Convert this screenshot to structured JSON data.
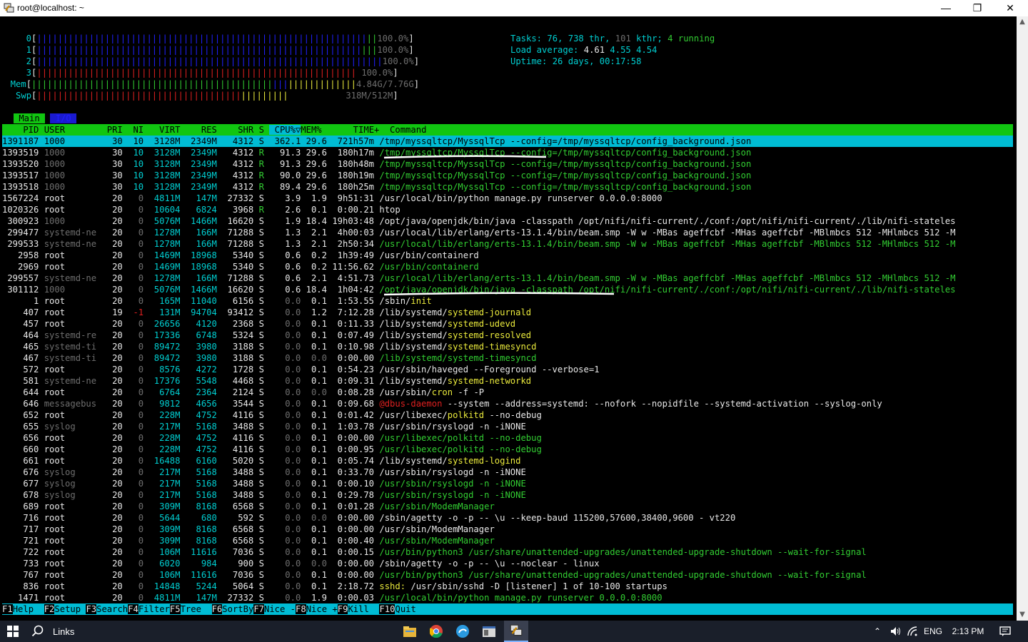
{
  "window": {
    "title": "root@localhost: ~"
  },
  "meters": {
    "cpu": [
      {
        "label": "0",
        "value": "100.0%"
      },
      {
        "label": "1",
        "value": "100.0%"
      },
      {
        "label": "2",
        "value": "100.0%"
      },
      {
        "label": "3",
        "value": "100.0%"
      }
    ],
    "mem": {
      "label": "Mem",
      "value": "4.84G/7.76G"
    },
    "swp": {
      "label": "Swp",
      "value": "318M/512M"
    }
  },
  "stats": {
    "tasks_label": "Tasks:",
    "tasks": "76,",
    "threads": "738",
    "threads_label": "thr,",
    "kthreads": "101",
    "kthreads_label": "kthr;",
    "running": "4",
    "running_label": "running",
    "load_label": "Load average:",
    "load1": "4.61",
    "load5": "4.55",
    "load15": "4.54",
    "uptime_label": "Uptime:",
    "uptime": "26 days, 00:17:58"
  },
  "tabs": [
    "Main",
    "I/O"
  ],
  "columns": [
    "PID",
    "USER",
    "PRI",
    "NI",
    "VIRT",
    "RES",
    "SHR",
    "S",
    "CPU%",
    "MEM%",
    "TIME+",
    "Command"
  ],
  "processes": [
    [
      "1391187",
      "1000",
      "30",
      "10",
      "3128M",
      "2349M",
      "4312",
      "S",
      "362.1",
      "29.6",
      "721h57m",
      "/tmp/myssqltcp/MyssqlTcp --config=/tmp/myssqltcp/config_background.json"
    ],
    [
      "1393519",
      "1000",
      "30",
      "10",
      "3128M",
      "2349M",
      "4312",
      "R",
      "91.3",
      "29.6",
      "180h17m",
      "/tmp/myssqltcp/MyssqlTcp --config=/tmp/myssqltcp/config_background.json"
    ],
    [
      "1393520",
      "1000",
      "30",
      "10",
      "3128M",
      "2349M",
      "4312",
      "R",
      "91.3",
      "29.6",
      "180h48m",
      "/tmp/myssqltcp/MyssqlTcp --config=/tmp/myssqltcp/config_background.json"
    ],
    [
      "1393517",
      "1000",
      "30",
      "10",
      "3128M",
      "2349M",
      "4312",
      "R",
      "90.0",
      "29.6",
      "180h19m",
      "/tmp/myssqltcp/MyssqlTcp --config=/tmp/myssqltcp/config_background.json"
    ],
    [
      "1393518",
      "1000",
      "30",
      "10",
      "3128M",
      "2349M",
      "4312",
      "R",
      "89.4",
      "29.6",
      "180h25m",
      "/tmp/myssqltcp/MyssqlTcp --config=/tmp/myssqltcp/config_background.json"
    ],
    [
      "1567224",
      "root",
      "20",
      "0",
      "4811M",
      "147M",
      "27332",
      "S",
      "3.9",
      "1.9",
      "9h51:31",
      "/usr/local/bin/python manage.py runserver 0.0.0.0:8000"
    ],
    [
      "1020326",
      "root",
      "20",
      "0",
      "10604",
      "6824",
      "3968",
      "R",
      "2.6",
      "0.1",
      "0:00.21",
      "htop"
    ],
    [
      "300923",
      "1000",
      "20",
      "0",
      "5076M",
      "1466M",
      "16620",
      "S",
      "1.9",
      "18.4",
      "19h03:48",
      "/opt/java/openjdk/bin/java -classpath /opt/nifi/nifi-current/./conf:/opt/nifi/nifi-current/./lib/nifi-stateles"
    ],
    [
      "299477",
      "systemd-ne",
      "20",
      "0",
      "1278M",
      "166M",
      "71288",
      "S",
      "1.3",
      "2.1",
      "4h00:03",
      "/usr/local/lib/erlang/erts-13.1.4/bin/beam.smp -W w -MBas ageffcbf -MHas ageffcbf -MBlmbcs 512 -MHlmbcs 512 -M"
    ],
    [
      "299533",
      "systemd-ne",
      "20",
      "0",
      "1278M",
      "166M",
      "71288",
      "S",
      "1.3",
      "2.1",
      "2h50:34",
      "/usr/local/lib/erlang/erts-13.1.4/bin/beam.smp -W w -MBas ageffcbf -MHas ageffcbf -MBlmbcs 512 -MHlmbcs 512 -M"
    ],
    [
      "2958",
      "root",
      "20",
      "0",
      "1469M",
      "18968",
      "5340",
      "S",
      "0.6",
      "0.2",
      "1h39:49",
      "/usr/bin/containerd"
    ],
    [
      "2969",
      "root",
      "20",
      "0",
      "1469M",
      "18968",
      "5340",
      "S",
      "0.6",
      "0.2",
      "11:56.62",
      "/usr/bin/containerd"
    ],
    [
      "299557",
      "systemd-ne",
      "20",
      "0",
      "1278M",
      "166M",
      "71288",
      "S",
      "0.6",
      "2.1",
      "4:51.73",
      "/usr/local/lib/erlang/erts-13.1.4/bin/beam.smp -W w -MBas ageffcbf -MHas ageffcbf -MBlmbcs 512 -MHlmbcs 512 -M"
    ],
    [
      "301112",
      "1000",
      "20",
      "0",
      "5076M",
      "1466M",
      "16620",
      "S",
      "0.6",
      "18.4",
      "1h04:42",
      "/opt/java/openjdk/bin/java -classpath /opt/nifi/nifi-current/./conf:/opt/nifi/nifi-current/./lib/nifi-stateles"
    ],
    [
      "1",
      "root",
      "20",
      "0",
      "165M",
      "11040",
      "6156",
      "S",
      "0.0",
      "0.1",
      "1:53.55",
      "/sbin/init"
    ],
    [
      "407",
      "root",
      "19",
      "-1",
      "131M",
      "94704",
      "93412",
      "S",
      "0.0",
      "1.2",
      "7:12.28",
      "/lib/systemd/systemd-journald"
    ],
    [
      "457",
      "root",
      "20",
      "0",
      "26656",
      "4120",
      "2368",
      "S",
      "0.0",
      "0.1",
      "0:11.33",
      "/lib/systemd/systemd-udevd"
    ],
    [
      "464",
      "systemd-re",
      "20",
      "0",
      "17336",
      "6748",
      "5324",
      "S",
      "0.0",
      "0.1",
      "0:07.49",
      "/lib/systemd/systemd-resolved"
    ],
    [
      "465",
      "systemd-ti",
      "20",
      "0",
      "89472",
      "3980",
      "3188",
      "S",
      "0.0",
      "0.1",
      "0:10.98",
      "/lib/systemd/systemd-timesyncd"
    ],
    [
      "467",
      "systemd-ti",
      "20",
      "0",
      "89472",
      "3980",
      "3188",
      "S",
      "0.0",
      "0.0",
      "0:00.00",
      "/lib/systemd/systemd-timesyncd"
    ],
    [
      "572",
      "root",
      "20",
      "0",
      "8576",
      "4272",
      "1728",
      "S",
      "0.0",
      "0.1",
      "0:54.23",
      "/usr/sbin/haveged --Foreground --verbose=1"
    ],
    [
      "581",
      "systemd-ne",
      "20",
      "0",
      "17376",
      "5548",
      "4468",
      "S",
      "0.0",
      "0.1",
      "0:09.31",
      "/lib/systemd/systemd-networkd"
    ],
    [
      "644",
      "root",
      "20",
      "0",
      "6764",
      "2364",
      "2124",
      "S",
      "0.0",
      "0.0",
      "0:08.28",
      "/usr/sbin/cron -f -P"
    ],
    [
      "646",
      "messagebus",
      "20",
      "0",
      "9812",
      "4656",
      "3544",
      "S",
      "0.0",
      "0.1",
      "0:09.68",
      "@dbus-daemon --system --address=systemd: --nofork --nopidfile --systemd-activation --syslog-only"
    ],
    [
      "652",
      "root",
      "20",
      "0",
      "228M",
      "4752",
      "4116",
      "S",
      "0.0",
      "0.1",
      "0:01.42",
      "/usr/libexec/polkitd --no-debug"
    ],
    [
      "655",
      "syslog",
      "20",
      "0",
      "217M",
      "5168",
      "3488",
      "S",
      "0.0",
      "0.1",
      "1:03.78",
      "/usr/sbin/rsyslogd -n -iNONE"
    ],
    [
      "656",
      "root",
      "20",
      "0",
      "228M",
      "4752",
      "4116",
      "S",
      "0.0",
      "0.1",
      "0:00.00",
      "/usr/libexec/polkitd --no-debug"
    ],
    [
      "660",
      "root",
      "20",
      "0",
      "228M",
      "4752",
      "4116",
      "S",
      "0.0",
      "0.1",
      "0:00.95",
      "/usr/libexec/polkitd --no-debug"
    ],
    [
      "661",
      "root",
      "20",
      "0",
      "16488",
      "6160",
      "5020",
      "S",
      "0.0",
      "0.1",
      "0:05.74",
      "/lib/systemd/systemd-logind"
    ],
    [
      "676",
      "syslog",
      "20",
      "0",
      "217M",
      "5168",
      "3488",
      "S",
      "0.0",
      "0.1",
      "0:33.70",
      "/usr/sbin/rsyslogd -n -iNONE"
    ],
    [
      "677",
      "syslog",
      "20",
      "0",
      "217M",
      "5168",
      "3488",
      "S",
      "0.0",
      "0.1",
      "0:00.10",
      "/usr/sbin/rsyslogd -n -iNONE"
    ],
    [
      "678",
      "syslog",
      "20",
      "0",
      "217M",
      "5168",
      "3488",
      "S",
      "0.0",
      "0.1",
      "0:29.78",
      "/usr/sbin/rsyslogd -n -iNONE"
    ],
    [
      "689",
      "root",
      "20",
      "0",
      "309M",
      "8168",
      "6568",
      "S",
      "0.0",
      "0.1",
      "0:01.28",
      "/usr/sbin/ModemManager"
    ],
    [
      "716",
      "root",
      "20",
      "0",
      "5644",
      "680",
      "592",
      "S",
      "0.0",
      "0.0",
      "0:00.00",
      "/sbin/agetty -o -p -- \\u --keep-baud 115200,57600,38400,9600 - vt220"
    ],
    [
      "717",
      "root",
      "20",
      "0",
      "309M",
      "8168",
      "6568",
      "S",
      "0.0",
      "0.1",
      "0:00.00",
      "/usr/sbin/ModemManager"
    ],
    [
      "721",
      "root",
      "20",
      "0",
      "309M",
      "8168",
      "6568",
      "S",
      "0.0",
      "0.1",
      "0:00.40",
      "/usr/sbin/ModemManager"
    ],
    [
      "722",
      "root",
      "20",
      "0",
      "106M",
      "11616",
      "7036",
      "S",
      "0.0",
      "0.1",
      "0:00.15",
      "/usr/bin/python3 /usr/share/unattended-upgrades/unattended-upgrade-shutdown --wait-for-signal"
    ],
    [
      "733",
      "root",
      "20",
      "0",
      "6020",
      "984",
      "900",
      "S",
      "0.0",
      "0.0",
      "0:00.00",
      "/sbin/agetty -o -p -- \\u --noclear - linux"
    ],
    [
      "767",
      "root",
      "20",
      "0",
      "106M",
      "11616",
      "7036",
      "S",
      "0.0",
      "0.1",
      "0:00.00",
      "/usr/bin/python3 /usr/share/unattended-upgrades/unattended-upgrade-shutdown --wait-for-signal"
    ],
    [
      "836",
      "root",
      "20",
      "0",
      "14848",
      "5244",
      "5064",
      "S",
      "0.0",
      "0.1",
      "2:18.72",
      "sshd: /usr/sbin/sshd -D [listener] 1 of 10-100 startups"
    ],
    [
      "1471",
      "root",
      "20",
      "0",
      "4811M",
      "147M",
      "27332",
      "S",
      "0.0",
      "1.9",
      "0:00.03",
      "/usr/local/bin/python manage.py runserver 0.0.0.0:8000"
    ]
  ],
  "thread_rows": [
    1,
    2,
    3,
    4,
    9,
    11,
    12,
    13,
    19,
    26,
    27,
    30,
    31,
    32,
    35,
    36,
    38,
    40
  ],
  "highlight_names": {
    "15": "systemd-journald",
    "16": "systemd-udevd",
    "17": "systemd-resolved",
    "18": "systemd-timesyncd",
    "19": "systemd-timesyncd",
    "21": "systemd-networkd",
    "22": "cron",
    "24": "polkitd",
    "26": "polkitd",
    "27": "polkitd",
    "28": "systemd-logind",
    "14": "init",
    "36": "python3",
    "38": "python3"
  },
  "function_keys": [
    {
      "key": "F1",
      "label": "Help  "
    },
    {
      "key": "F2",
      "label": "Setup "
    },
    {
      "key": "F3",
      "label": "Search"
    },
    {
      "key": "F4",
      "label": "Filter"
    },
    {
      "key": "F5",
      "label": "Tree  "
    },
    {
      "key": "F6",
      "label": "SortBy"
    },
    {
      "key": "F7",
      "label": "Nice -"
    },
    {
      "key": "F8",
      "label": "Nice +"
    },
    {
      "key": "F9",
      "label": "Kill  "
    },
    {
      "key": "F10",
      "label": "Quit"
    }
  ],
  "taskbar": {
    "search_label": "Links",
    "lang": "ENG",
    "time": "2:13 PM"
  },
  "colors": {
    "cyan": "#00ced1",
    "green": "#32cd32",
    "highlight_bg": "#00bcd4",
    "header_bg": "#11c611"
  }
}
